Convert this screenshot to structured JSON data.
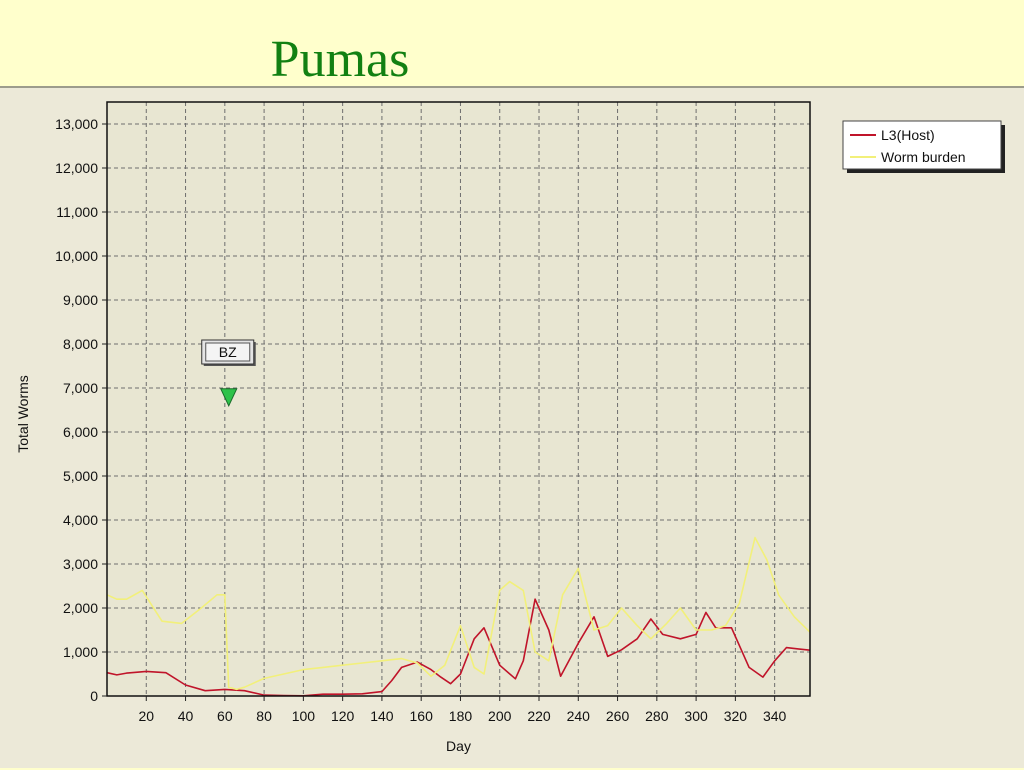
{
  "slide": {
    "title": "Pumas",
    "background": "#FFFFCC",
    "title_color": "#128012"
  },
  "chart_data": {
    "type": "line",
    "title": "",
    "xlabel": "Day",
    "ylabel": "Total Worms",
    "xlim": [
      0,
      358
    ],
    "ylim": [
      0,
      13500
    ],
    "xticks": [
      20,
      40,
      60,
      80,
      100,
      120,
      140,
      160,
      180,
      200,
      220,
      240,
      260,
      280,
      300,
      320,
      340
    ],
    "yticks": [
      0,
      1000,
      2000,
      3000,
      4000,
      5000,
      6000,
      7000,
      8000,
      9000,
      10000,
      11000,
      12000,
      13000
    ],
    "ytick_labels": [
      "0",
      "1,000",
      "2,000",
      "3,000",
      "4,000",
      "5,000",
      "6,000",
      "7,000",
      "8,000",
      "9,000",
      "10,000",
      "11,000",
      "12,000",
      "13,000"
    ],
    "grid": true,
    "legend_position": "top-right",
    "plot_background": "#E8E6D2",
    "series": [
      {
        "name": "L3(Host)",
        "color": "#C0142A",
        "x": [
          0,
          5,
          10,
          20,
          30,
          40,
          50,
          60,
          70,
          80,
          90,
          100,
          110,
          120,
          130,
          140,
          145,
          150,
          158,
          165,
          170,
          175,
          180,
          187,
          192,
          200,
          208,
          212,
          218,
          225,
          231,
          240,
          248,
          255,
          262,
          270,
          277,
          283,
          292,
          300,
          305,
          310,
          318,
          327,
          334,
          340,
          346,
          352,
          358
        ],
        "y": [
          530,
          480,
          520,
          560,
          530,
          250,
          120,
          150,
          120,
          20,
          10,
          5,
          40,
          40,
          50,
          100,
          350,
          650,
          770,
          600,
          430,
          280,
          500,
          1300,
          1550,
          700,
          390,
          800,
          2200,
          1500,
          450,
          1200,
          1800,
          900,
          1050,
          1300,
          1750,
          1400,
          1300,
          1400,
          1900,
          1550,
          1550,
          650,
          430,
          800,
          1100,
          1070,
          1040
        ]
      },
      {
        "name": "Worm burden",
        "color": "#F2F07A",
        "x": [
          0,
          5,
          10,
          18,
          28,
          38,
          48,
          56,
          60,
          62,
          66,
          70,
          80,
          90,
          100,
          110,
          120,
          130,
          140,
          150,
          158,
          165,
          172,
          180,
          187,
          192,
          200,
          205,
          212,
          218,
          225,
          232,
          240,
          248,
          255,
          262,
          270,
          277,
          285,
          292,
          300,
          308,
          315,
          322,
          330,
          336,
          342,
          350,
          358
        ],
        "y": [
          2300,
          2200,
          2200,
          2400,
          1700,
          1650,
          2000,
          2300,
          2300,
          200,
          150,
          200,
          400,
          500,
          600,
          650,
          700,
          750,
          800,
          850,
          750,
          450,
          700,
          1600,
          650,
          500,
          2400,
          2600,
          2400,
          1000,
          800,
          2300,
          2900,
          1500,
          1600,
          2000,
          1600,
          1300,
          1650,
          2000,
          1500,
          1500,
          1600,
          2100,
          3600,
          3100,
          2300,
          1800,
          1450
        ]
      }
    ],
    "annotations": [
      {
        "label": "BZ",
        "x": 62,
        "marker_y": 6800,
        "marker_color": "#2EC24A"
      }
    ]
  }
}
